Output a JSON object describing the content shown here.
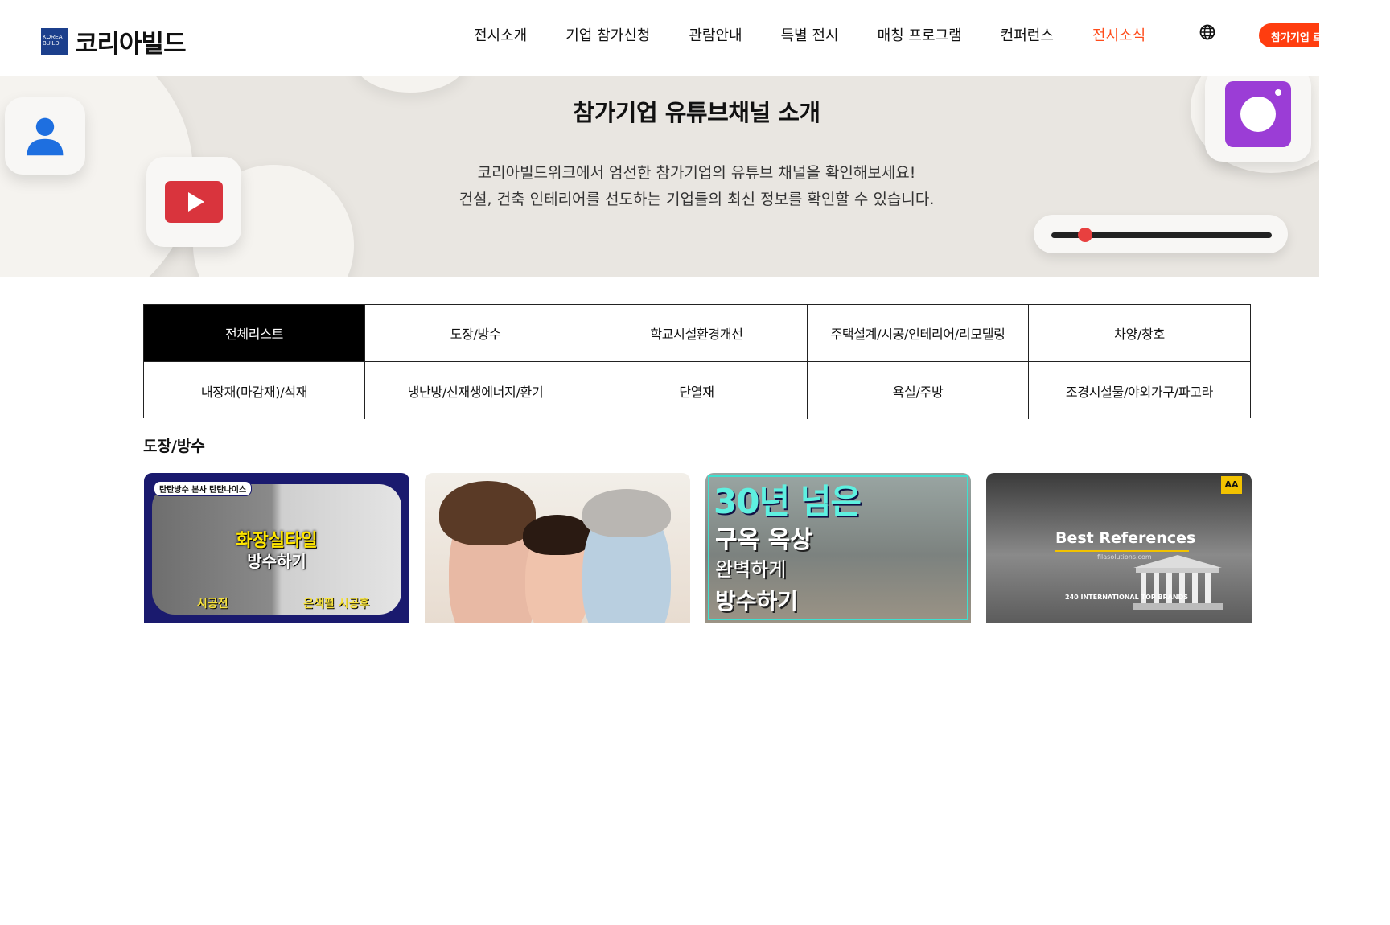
{
  "header": {
    "logo_mark": "KOREA BUILD",
    "logo_text": "코리아빌드",
    "nav": [
      {
        "label": "전시소개",
        "active": false
      },
      {
        "label": "기업 참가신청",
        "active": false
      },
      {
        "label": "관람안내",
        "active": false
      },
      {
        "label": "특별 전시",
        "active": false
      },
      {
        "label": "매칭 프로그램",
        "active": false
      },
      {
        "label": "컨퍼런스",
        "active": false
      },
      {
        "label": "전시소식",
        "active": true
      }
    ],
    "globe_icon": "globe-icon",
    "cta_label": "참가기업 로"
  },
  "hero": {
    "title": "참가기업 유튜브채널 소개",
    "desc_line1": "코리아빌드위크에서 엄선한 참가기업의 유튜브 채널을 확인해보세요!",
    "desc_line2": "건설, 건축 인테리어를 선도하는 기업들의 최신 정보를 확인할 수 있습니다."
  },
  "categories": [
    {
      "label": "전체리스트",
      "active": true
    },
    {
      "label": "도장/방수",
      "active": false
    },
    {
      "label": "학교시설환경개선",
      "active": false
    },
    {
      "label": "주택설계/시공/인테리어/리모델링",
      "active": false
    },
    {
      "label": "차양/창호",
      "active": false
    },
    {
      "label": "내장재(마감재)/석재",
      "active": false
    },
    {
      "label": "냉난방/신재생에너지/환기",
      "active": false
    },
    {
      "label": "단열재",
      "active": false
    },
    {
      "label": "욕실/주방",
      "active": false
    },
    {
      "label": "조경시설물/야외가구/파고라",
      "active": false
    }
  ],
  "section_title": "도장/방수",
  "videos": {
    "v1": {
      "tag": "탄탄방수 본사 탄탄나이스",
      "big": "화장실타일",
      "big2": "방수하기",
      "before": "시공전",
      "after": "은색펄 시공후"
    },
    "v3": {
      "t1": "30년 넘은",
      "t2": "구옥 옥상",
      "t3": "완벽하게",
      "t4": "방수하기"
    },
    "v4": {
      "logo": "AA",
      "title": "Best References",
      "site": "filasolutions.com",
      "badge": "240 INTERNATIONAL TOP BRANDS"
    }
  },
  "colors": {
    "accent": "#ff4d1c",
    "cta": "#ff3d0f",
    "hero_bg": "#e9e6e1"
  }
}
